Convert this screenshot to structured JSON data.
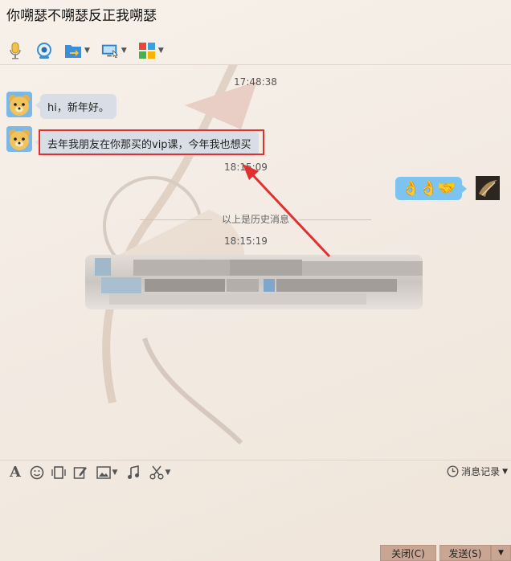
{
  "window": {
    "title": "你嗍瑟不嗍瑟反正我嗍瑟"
  },
  "toolbar": {
    "items": [
      {
        "icon": "microphone-icon"
      },
      {
        "icon": "webcam-icon"
      },
      {
        "icon": "file-transfer-icon",
        "dropdown": true
      },
      {
        "icon": "remote-desktop-icon",
        "dropdown": true
      },
      {
        "icon": "apps-icon",
        "dropdown": true
      }
    ]
  },
  "messages": {
    "time1": "17:48:38",
    "msg1": "hi，新年好。",
    "msg2": "去年我朋友在你那买的vip课，今年我也想买",
    "time2": "18:15:09",
    "msg3_emoji": "👌👌🤝",
    "history_divider": "以上是历史消息",
    "time3": "18:15:19"
  },
  "input_toolbar": {
    "font_glyph": "A",
    "history_label": "消息记录"
  },
  "buttons": {
    "close": "关闭(C)",
    "send": "发送(S)"
  },
  "colors": {
    "highlight_box": "#e03030",
    "arrow": "#e03030",
    "bubble_left": "#d8dde6",
    "bubble_right": "#7cc4ef",
    "button": "#c9a693"
  }
}
